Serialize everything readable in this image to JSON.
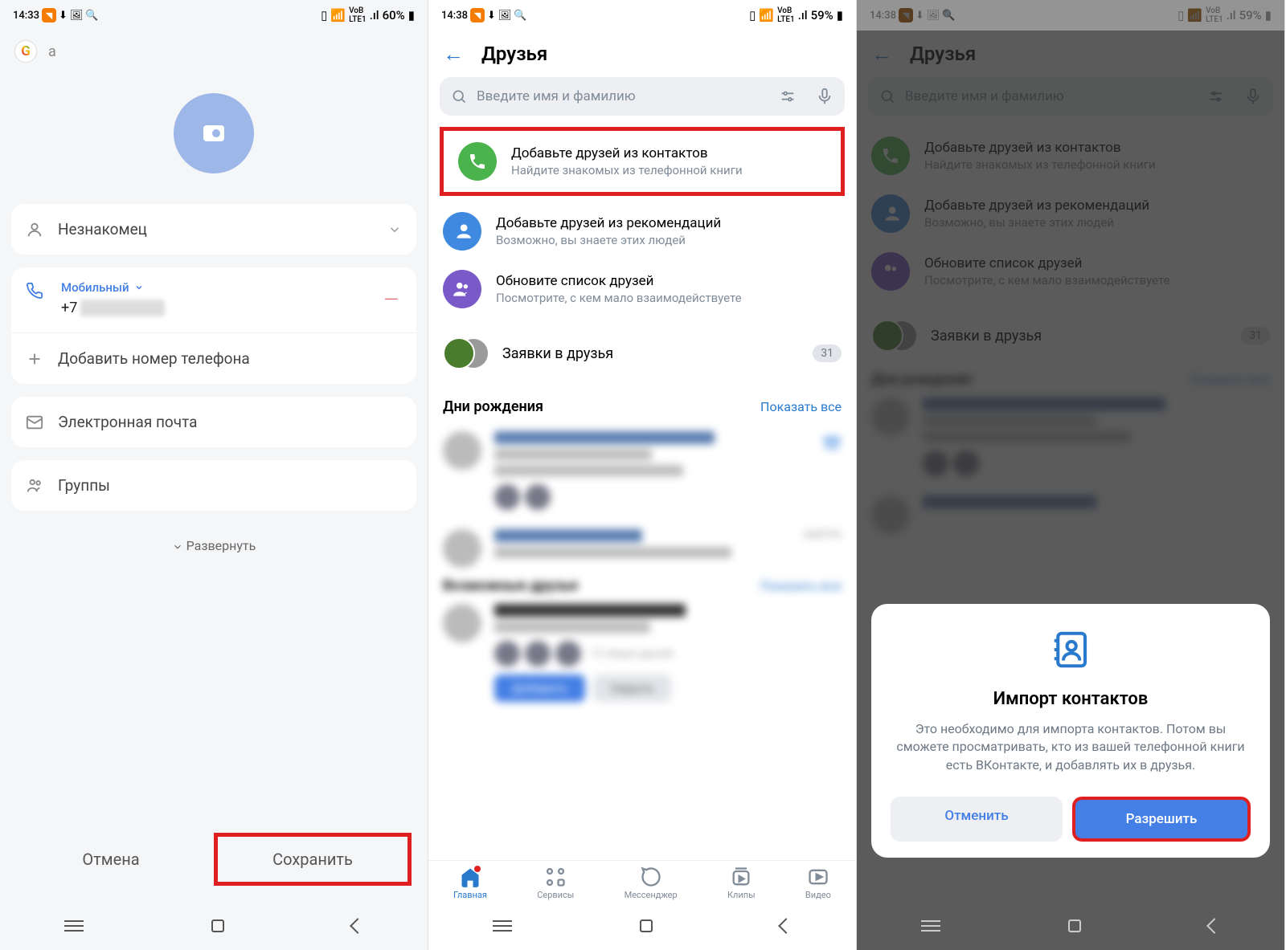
{
  "screen1": {
    "time": "14:33",
    "battery": "60%",
    "search_val": "а",
    "name_field": "Незнакомец",
    "phone_type": "Мобильный",
    "phone_value": "+7",
    "add_number": "Добавить номер телефона",
    "email": "Электронная почта",
    "groups": "Группы",
    "expand": "Развернуть",
    "cancel": "Отмена",
    "save": "Сохранить"
  },
  "screen2": {
    "time": "14:38",
    "battery": "59%",
    "title": "Друзья",
    "search_placeholder": "Введите имя и фамилию",
    "rows": {
      "contacts": {
        "t": "Добавьте друзей из контактов",
        "s": "Найдите знакомых из телефонной книги"
      },
      "recom": {
        "t": "Добавьте друзей из рекомендаций",
        "s": "Возможно, вы знаете этих людей"
      },
      "upd": {
        "t": "Обновите список друзей",
        "s": "Посмотрите, с кем мало взаимодействуете"
      }
    },
    "requests": "Заявки в друзья",
    "requests_badge": "31",
    "birthdays": "Дни рождения",
    "show_all": "Показать все",
    "possible": "Возможные друзья",
    "add_btn": "Добавить",
    "hide_btn": "Скрыть",
    "tabs": {
      "home": "Главная",
      "services": "Сервисы",
      "messenger": "Мессенджер",
      "clips": "Клипы",
      "video": "Видео"
    }
  },
  "screen3": {
    "time": "14:38",
    "battery": "59%",
    "popup": {
      "title": "Импорт контактов",
      "text": "Это необходимо для импорта контактов. Потом вы сможете просматривать, кто из вашей телефонной книги есть ВКонтакте, и добавлять их в друзья.",
      "cancel": "Отменить",
      "allow": "Разрешить"
    }
  }
}
